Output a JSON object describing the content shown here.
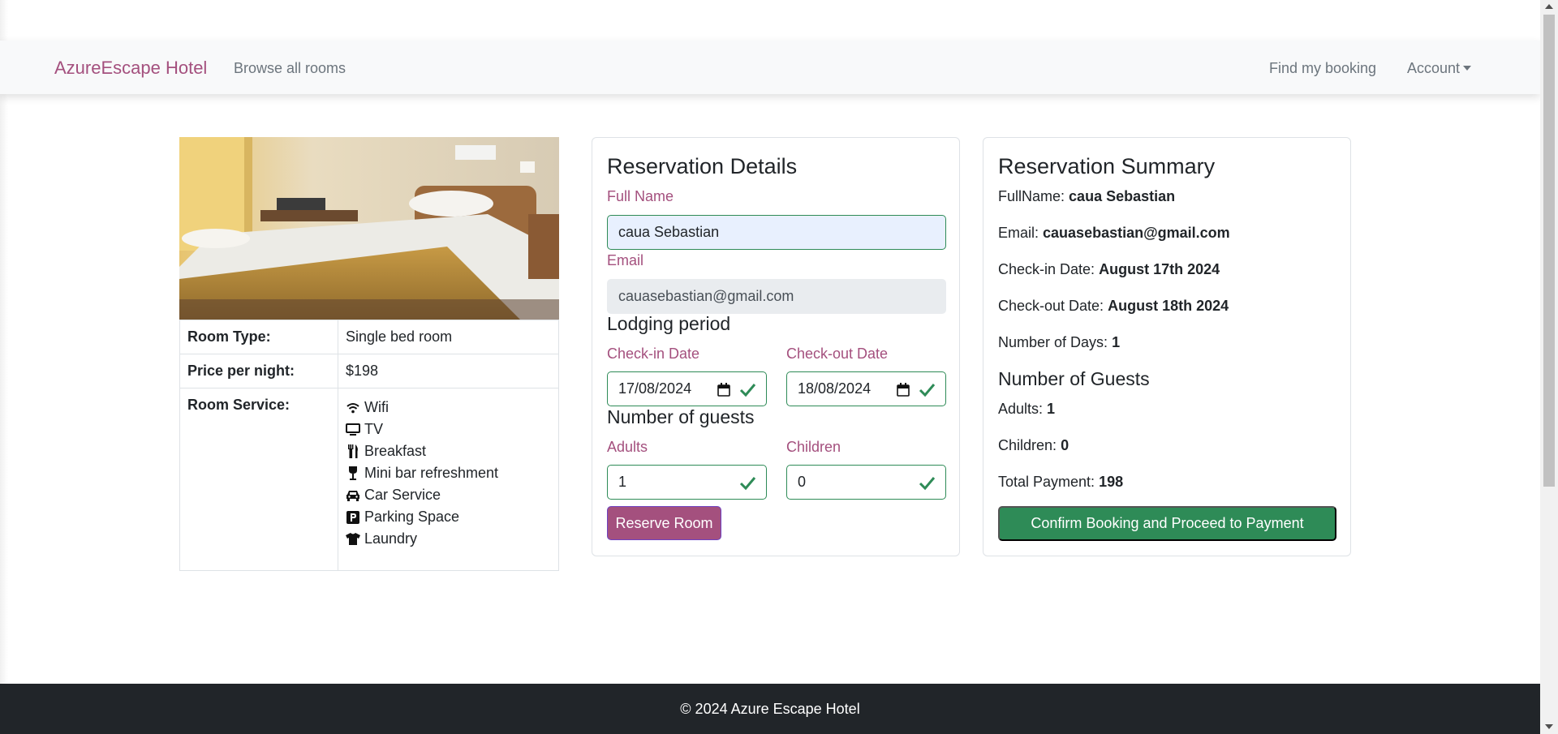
{
  "nav": {
    "brand": "AzureEscape Hotel",
    "browse": "Browse all rooms",
    "find": "Find my booking",
    "account": "Account"
  },
  "room": {
    "rows": [
      {
        "key": "Room Type:",
        "value": "Single bed room"
      },
      {
        "key": "Price per night:",
        "value": "$198"
      }
    ],
    "service_key": "Room Service:",
    "services": [
      {
        "label": "Wifi",
        "icon": "wifi-icon"
      },
      {
        "label": "TV",
        "icon": "tv-icon"
      },
      {
        "label": "Breakfast",
        "icon": "utensils-icon"
      },
      {
        "label": "Mini bar refreshment",
        "icon": "wine-glass-icon"
      },
      {
        "label": "Car Service",
        "icon": "car-icon"
      },
      {
        "label": "Parking Space",
        "icon": "parking-icon"
      },
      {
        "label": "Laundry",
        "icon": "tshirt-icon"
      }
    ]
  },
  "reservation": {
    "title": "Reservation Details",
    "full_name_label": "Full Name",
    "full_name_value": "caua Sebastian",
    "email_label": "Email",
    "email_value": "cauasebastian@gmail.com",
    "lodging_heading": "Lodging period",
    "checkin_label": "Check-in Date",
    "checkin_value": "17/08/2024",
    "checkout_label": "Check-out Date",
    "checkout_value": "18/08/2024",
    "guests_heading": "Number of guests",
    "adults_label": "Adults",
    "adults_value": "1",
    "children_label": "Children",
    "children_value": "0",
    "reserve_button": "Reserve Room"
  },
  "summary": {
    "title": "Reservation Summary",
    "fullname_label": "FullName:",
    "fullname_value": "caua Sebastian",
    "email_label": "Email:",
    "email_value": "cauasebastian@gmail.com",
    "checkin_label": "Check-in Date:",
    "checkin_value": "August 17th 2024",
    "checkout_label": "Check-out Date:",
    "checkout_value": "August 18th 2024",
    "days_label": "Number of Days:",
    "days_value": "1",
    "guests_heading": "Number of Guests",
    "adults_label": "Adults:",
    "adults_value": "1",
    "children_label": "Children:",
    "children_value": "0",
    "total_label": "Total Payment:",
    "total_value": "198",
    "confirm_button": "Confirm Booking and Proceed to Payment"
  },
  "footer": {
    "text": "© 2024 Azure Escape Hotel"
  },
  "colors": {
    "brand": "#a4507e",
    "success": "#2e8b57",
    "footer_bg": "#212529"
  }
}
